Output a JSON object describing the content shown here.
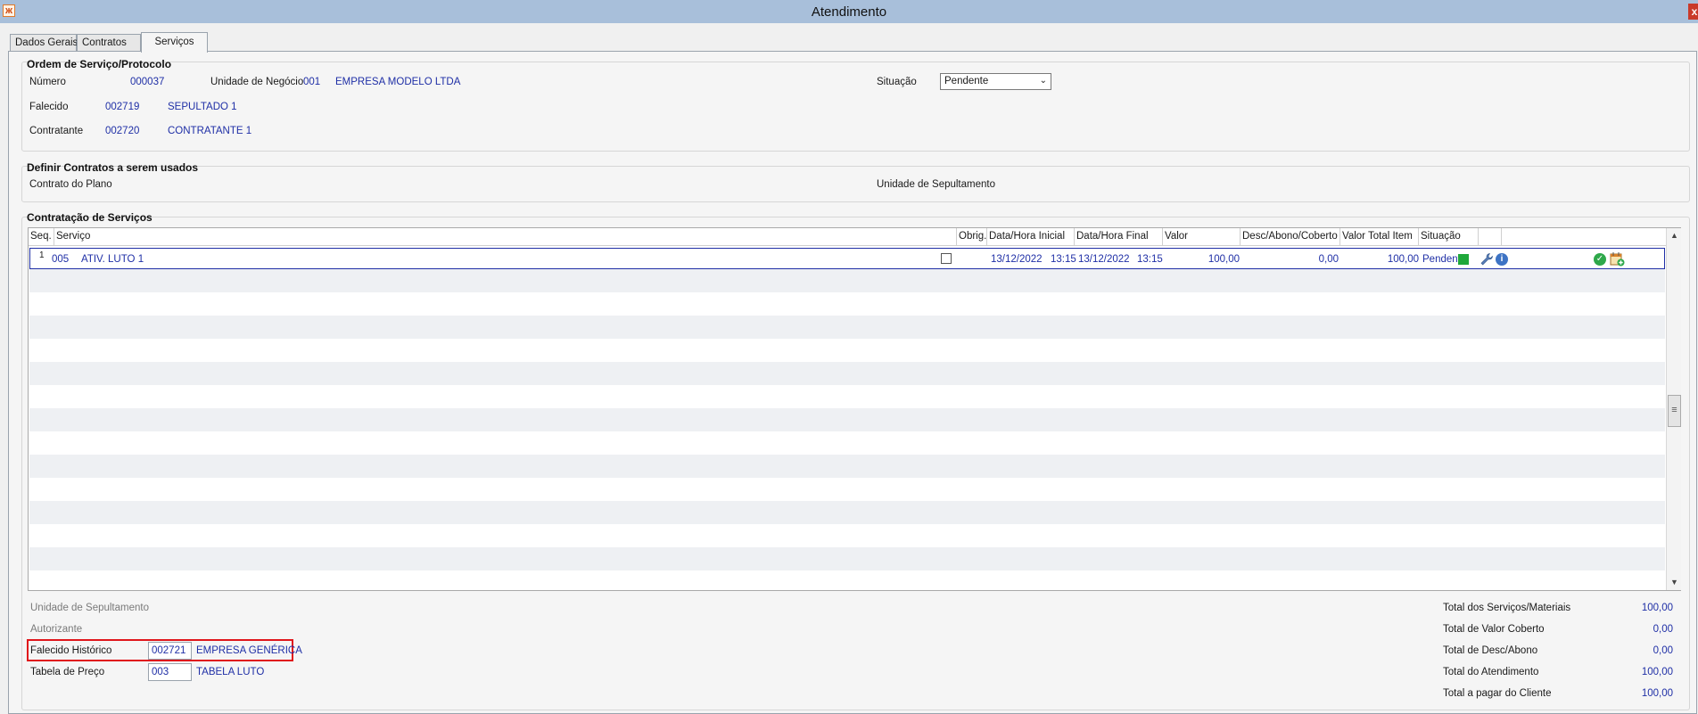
{
  "window": {
    "title": "Atendimento",
    "close": "x"
  },
  "tabs": [
    {
      "label": "Dados Gerais"
    },
    {
      "label": "Contratos"
    },
    {
      "label": "Serviços"
    }
  ],
  "ordem": {
    "title": "Ordem de Serviço/Protocolo",
    "numero_label": "Número",
    "numero_value": "000037",
    "unidade_label": "Unidade de Negócio",
    "unidade_code": "001",
    "unidade_name": "EMPRESA MODELO LTDA",
    "situacao_label": "Situação",
    "situacao_value": "Pendente",
    "falecido_label": "Falecido",
    "falecido_code": "002719",
    "falecido_name": "SEPULTADO 1",
    "contratante_label": "Contratante",
    "contratante_code": "002720",
    "contratante_name": "CONTRATANTE 1"
  },
  "contratos": {
    "title": "Definir Contratos a serem usados",
    "plano_label": "Contrato do Plano",
    "unidade_label": "Unidade de Sepultamento"
  },
  "servicos": {
    "title": "Contratação de Serviços",
    "columns": [
      "Seq.",
      "Serviço",
      "Obrig.",
      "Data/Hora Inicial",
      "Data/Hora Final",
      "Valor",
      "Desc/Abono/Coberto",
      "Valor Total Item",
      "Situação"
    ],
    "rows": [
      {
        "seq": "1",
        "codigo": "005",
        "servico": "ATIV. LUTO 1",
        "obrig": false,
        "data_ini": "13/12/2022",
        "hora_ini": "13:15",
        "data_fim": "13/12/2022",
        "hora_fim": "13:15",
        "valor": "100,00",
        "desc": "0,00",
        "total": "100,00",
        "situacao": "Pendente"
      }
    ]
  },
  "bottom": {
    "unidade_sep_label": "Unidade de Sepultamento",
    "autorizante_label": "Autorizante",
    "falecido_hist_label": "Falecido Histórico",
    "falecido_hist_code": "002721",
    "falecido_hist_name": "EMPRESA GENÉRICA",
    "tabela_label": "Tabela de Preço",
    "tabela_code": "003",
    "tabela_name": "TABELA LUTO"
  },
  "totals": [
    {
      "label": "Total dos Serviços/Materiais",
      "value": "100,00"
    },
    {
      "label": "Total de Valor Coberto",
      "value": "0,00"
    },
    {
      "label": "Total de Desc/Abono",
      "value": "0,00"
    },
    {
      "label": "Total do Atendimento",
      "value": "100,00"
    },
    {
      "label": "Total a pagar do Cliente",
      "value": "100,00"
    }
  ],
  "icons": {
    "status": "status-green-square",
    "wrench": "wrench-icon",
    "info": "info-icon",
    "confirm": "check-circle-icon",
    "schedule": "calendar-add-icon"
  },
  "colors": {
    "value_text": "#1f2fa6",
    "highlight": "#e0161b",
    "titlebar": "#a8bfda",
    "status_green": "#1fa83a"
  }
}
